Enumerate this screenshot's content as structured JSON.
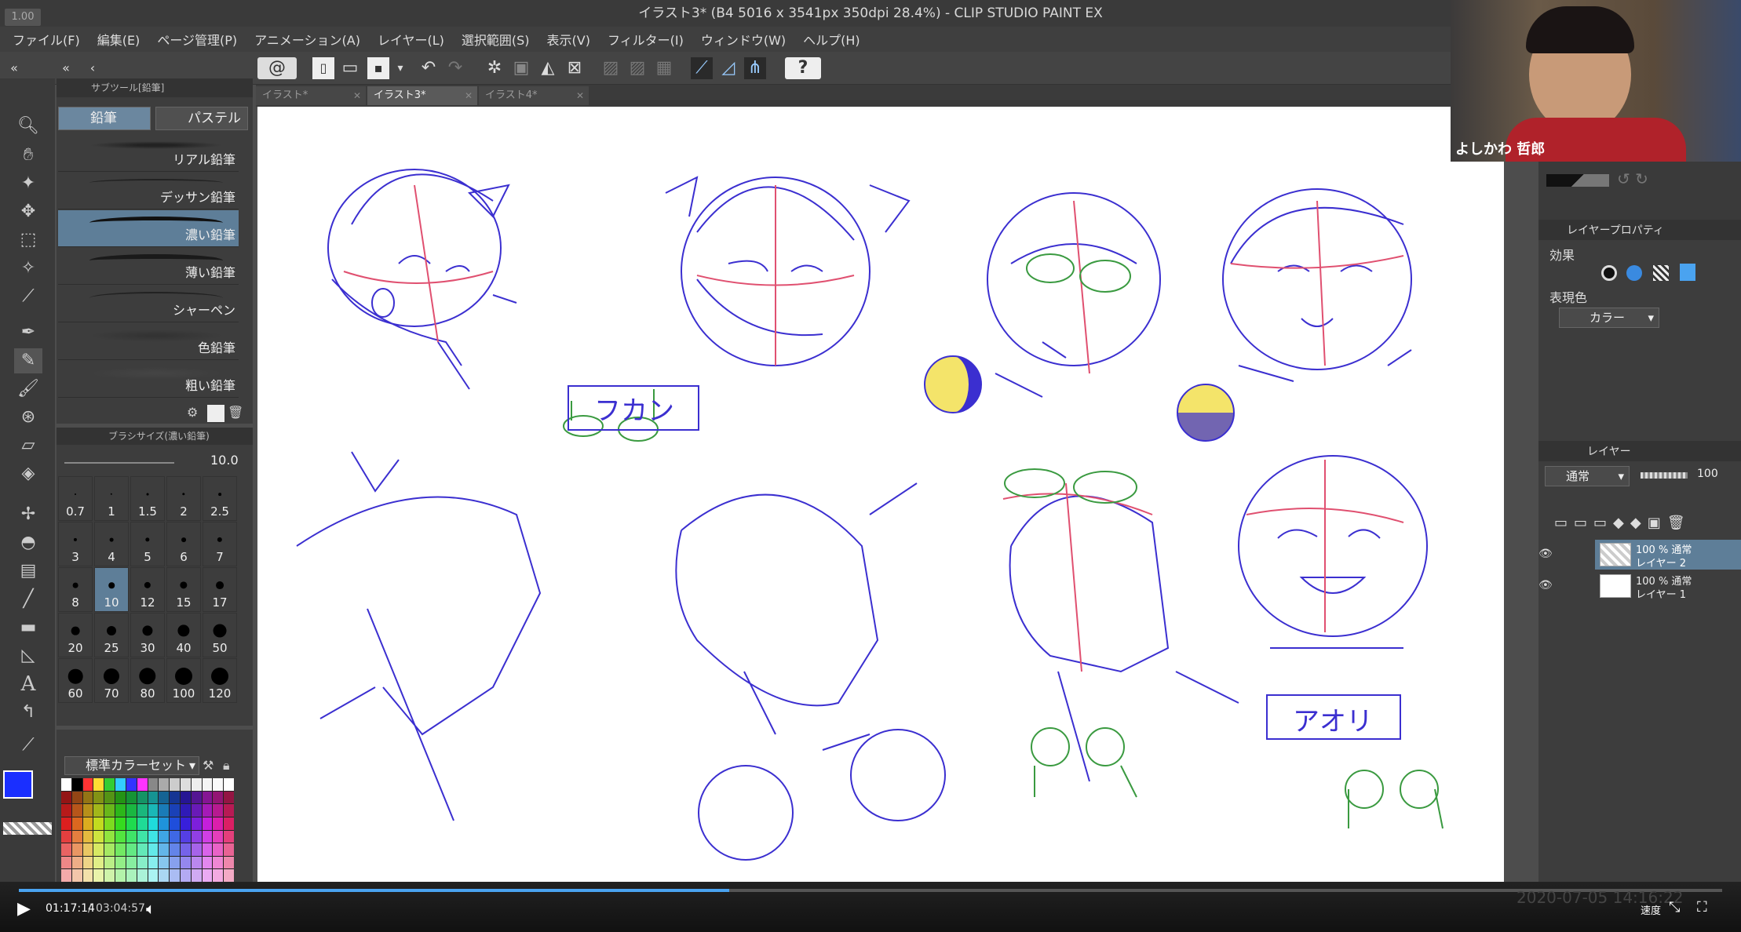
{
  "window": {
    "title": "イラスト3* (B4 5016 x 3541px 350dpi 28.4%)  - CLIP STUDIO PAINT EX",
    "zoom_chip": "1.00"
  },
  "menu": [
    "ファイル(F)",
    "編集(E)",
    "ページ管理(P)",
    "アニメーション(A)",
    "レイヤー(L)",
    "選択範囲(S)",
    "表示(V)",
    "フィルター(I)",
    "ウィンドウ(W)",
    "ヘルプ(H)"
  ],
  "tabs": [
    {
      "label": "イラスト*",
      "active": false
    },
    {
      "label": "イラスト3*",
      "active": true
    },
    {
      "label": "イラスト4*",
      "active": false
    }
  ],
  "subtool": {
    "header": "サブツール[鉛筆]",
    "tab_pencil": "鉛筆",
    "tab_pastel": "パステル",
    "brushes": [
      "リアル鉛筆",
      "デッサン鉛筆",
      "濃い鉛筆",
      "薄い鉛筆",
      "シャーペン",
      "色鉛筆",
      "粗い鉛筆"
    ],
    "selected_brush": "濃い鉛筆"
  },
  "brush_size": {
    "header": "ブラシサイズ(濃い鉛筆)",
    "value": "10.0",
    "sizes": [
      "0.7",
      "1",
      "1.5",
      "2",
      "2.5",
      "3",
      "4",
      "5",
      "6",
      "7",
      "8",
      "10",
      "12",
      "15",
      "17",
      "20",
      "25",
      "30",
      "40",
      "50",
      "60",
      "70",
      "80",
      "100",
      "120"
    ],
    "selected": "10"
  },
  "color_set": {
    "label": "標準カラーセット",
    "main_color": "#1a2fff",
    "sub_color": "#ff1f6a"
  },
  "right_panel": {
    "layer_property_tab": "レイヤープロパティ",
    "effect_label": "効果",
    "expression_label": "表現色",
    "expression_value": "カラー",
    "layer_tab": "レイヤー",
    "blend_mode": "通常",
    "opacity": "100",
    "layers": [
      {
        "mode": "100 % 通常",
        "name": "レイヤー 2",
        "selected": true
      },
      {
        "mode": "100 % 通常",
        "name": "レイヤー 1",
        "selected": false
      }
    ]
  },
  "webcam": {
    "name": "よしかわ 哲郎"
  },
  "canvas_text": {
    "fukan": "フカン",
    "aori": "アオリ"
  },
  "player": {
    "current": "01:17:14",
    "separator": "/",
    "total": "03:04:57",
    "speed_label": "速度",
    "progress": 0.417,
    "timestamp": "2020-07-05 14:16:22"
  }
}
